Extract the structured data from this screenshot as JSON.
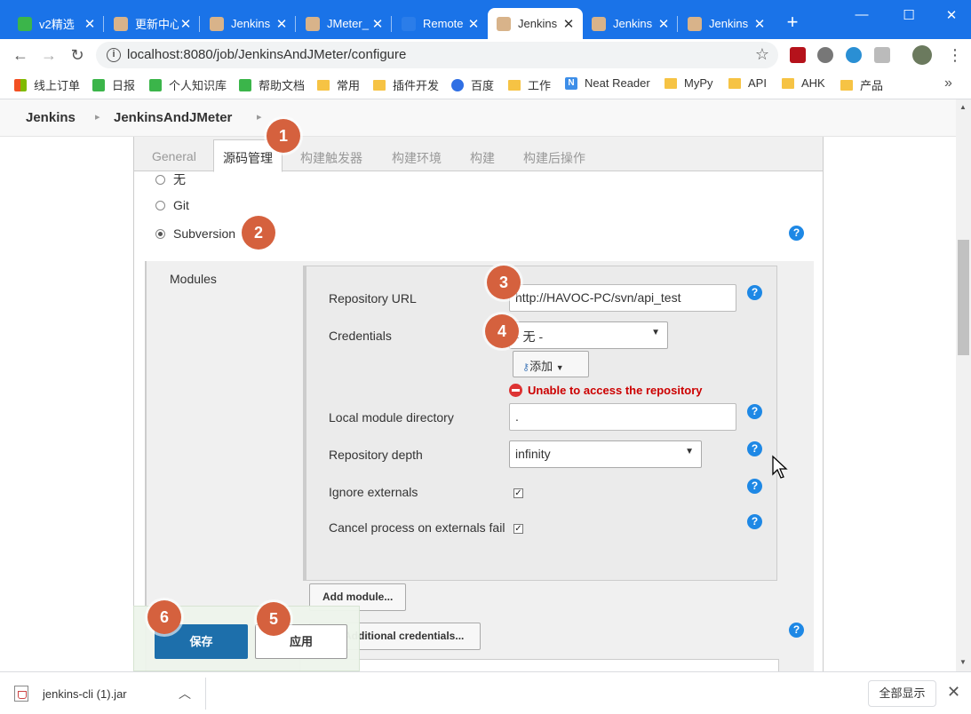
{
  "browser": {
    "tabs": [
      {
        "title": "v2精选",
        "favicon": "leaf-icon",
        "color": "#3bb54a",
        "active": false
      },
      {
        "title": "更新中心",
        "favicon": "jenkins-icon",
        "color": "#d8b38a",
        "active": false
      },
      {
        "title": "Jenkins",
        "favicon": "jenkins-icon",
        "color": "#d8b38a",
        "active": false
      },
      {
        "title": "JMeter_",
        "favicon": "jenkins-icon",
        "color": "#d8b38a",
        "active": false
      },
      {
        "title": "Remote",
        "favicon": "remote-icon",
        "color": "#2b7de9",
        "active": false
      },
      {
        "title": "Jenkins",
        "favicon": "jenkins-icon",
        "color": "#d8b38a",
        "active": true
      },
      {
        "title": "Jenkins",
        "favicon": "jenkins-icon",
        "color": "#d8b38a",
        "active": false
      },
      {
        "title": "Jenkins",
        "favicon": "jenkins-icon",
        "color": "#d8b38a",
        "active": false
      }
    ],
    "new_tab": "+",
    "tab_close": "✕",
    "window_controls": {
      "minimize": "—",
      "maximize": "☐",
      "close": "✕"
    },
    "url": "localhost:8080/job/JenkinsAndJMeter/configure",
    "bookmarks": [
      {
        "label": "线上订单",
        "icon": "windows-icon",
        "color": "#f25022"
      },
      {
        "label": "日报",
        "icon": "leaf-icon",
        "color": "#3bb54a"
      },
      {
        "label": "个人知识库",
        "icon": "leaf-icon",
        "color": "#3bb54a"
      },
      {
        "label": "帮助文档",
        "icon": "leaf-icon",
        "color": "#3bb54a"
      },
      {
        "label": "常用",
        "icon": "folder-icon",
        "color": "#f6c344"
      },
      {
        "label": "插件开发",
        "icon": "folder-icon",
        "color": "#f6c344"
      },
      {
        "label": "百度",
        "icon": "baidu-icon",
        "color": "#2f6fe4"
      },
      {
        "label": "工作",
        "icon": "folder-icon",
        "color": "#f6c344"
      },
      {
        "label": "Neat Reader",
        "icon": "n-icon",
        "color": "#3d8ee8"
      },
      {
        "label": "MyPy",
        "icon": "folder-icon",
        "color": "#f6c344"
      },
      {
        "label": "API",
        "icon": "folder-icon",
        "color": "#f6c344"
      },
      {
        "label": "AHK",
        "icon": "folder-icon",
        "color": "#f6c344"
      },
      {
        "label": "产品",
        "icon": "folder-icon",
        "color": "#f6c344"
      }
    ],
    "bookmarks_more": "»"
  },
  "jenkins": {
    "breadcrumb": [
      "Jenkins",
      "JenkinsAndJMeter"
    ],
    "config_tabs": [
      "General",
      "源码管理",
      "构建触发器",
      "构建环境",
      "构建",
      "构建后操作"
    ],
    "active_tab": "源码管理",
    "scm_options": [
      {
        "label": "无",
        "selected": false
      },
      {
        "label": "Git",
        "selected": false
      },
      {
        "label": "Subversion",
        "selected": true
      }
    ],
    "modules_label": "Modules",
    "fields": {
      "repository_url": {
        "label": "Repository URL",
        "value": "http://HAVOC-PC/svn/api_test"
      },
      "credentials": {
        "label": "Credentials",
        "value": "- 无 -"
      },
      "add_button": "添加",
      "error": "Unable to access the repository",
      "local_dir": {
        "label": "Local module directory",
        "value": "."
      },
      "depth": {
        "label": "Repository depth",
        "value": "infinity"
      },
      "ignore_externals": {
        "label": "Ignore externals",
        "checked": true
      },
      "cancel_externals": {
        "label": "Cancel process on externals fail",
        "checked": true
      }
    },
    "add_module_button": "Add module...",
    "additional_credentials_button": "Additional credentials...",
    "save_button": "保存",
    "apply_button": "应用",
    "annotations": [
      "1",
      "2",
      "3",
      "4",
      "5",
      "6"
    ],
    "accent_color": "#1d6fab",
    "badge_color": "#d5613e",
    "error_color": "#cc0000"
  },
  "downloads": {
    "file": "jenkins-cli (1).jar",
    "show_all": "全部显示",
    "close": "✕"
  }
}
